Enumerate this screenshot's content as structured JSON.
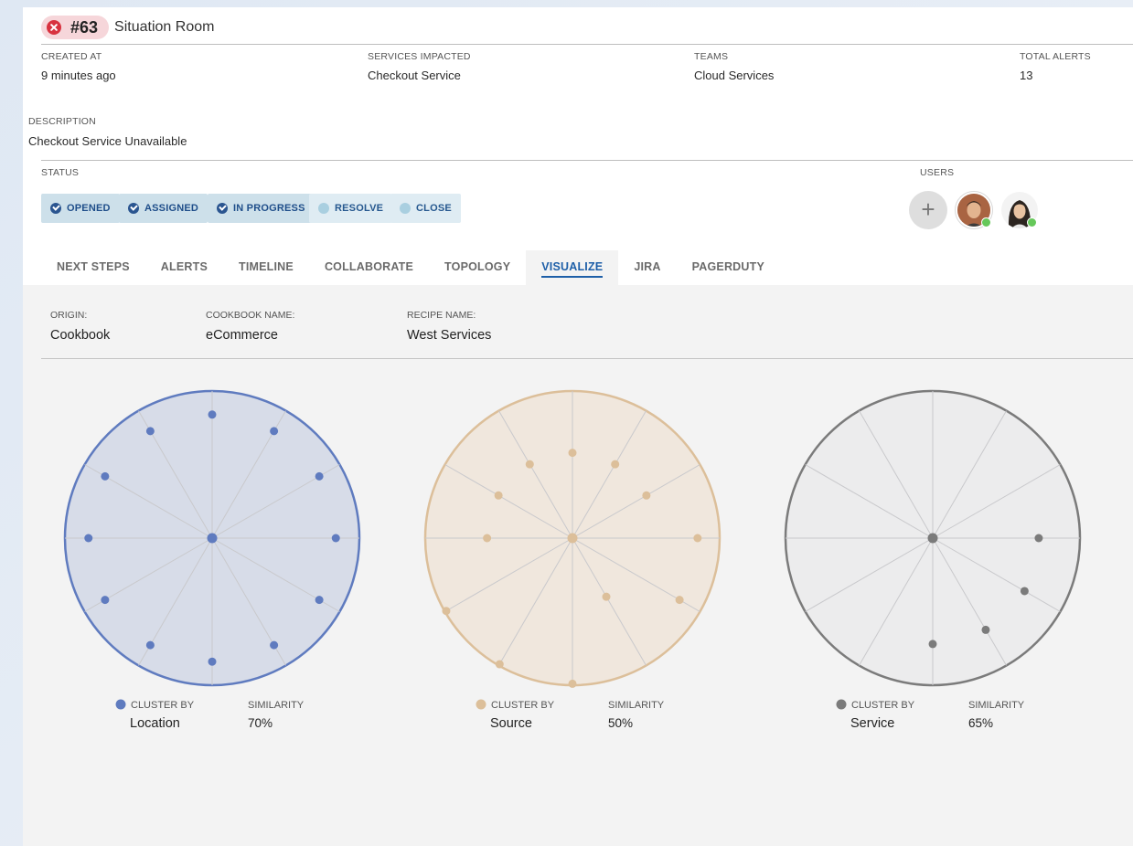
{
  "header": {
    "id": "#63",
    "title": "Situation Room"
  },
  "details": {
    "created_at_label": "CREATED AT",
    "created_at_value": "9 minutes ago",
    "services_label": "SERVICES IMPACTED",
    "services_value": "Checkout Service",
    "teams_label": "TEAMS",
    "teams_value": "Cloud Services",
    "alerts_label": "TOTAL ALERTS",
    "alerts_value": "13",
    "description_label": "DESCRIPTION",
    "description_value": "Checkout Service Unavailable"
  },
  "status": {
    "label": "STATUS",
    "steps": [
      {
        "label": "OPENED",
        "done": true
      },
      {
        "label": "ASSIGNED",
        "done": true
      },
      {
        "label": "IN PROGRESS",
        "done": true
      },
      {
        "label": "RESOLVE",
        "done": false
      },
      {
        "label": "CLOSE",
        "done": false
      }
    ]
  },
  "users": {
    "label": "USERS",
    "add_symbol": "+"
  },
  "tabs": [
    "NEXT STEPS",
    "ALERTS",
    "TIMELINE",
    "COLLABORATE",
    "TOPOLOGY",
    "VISUALIZE",
    "JIRA",
    "PAGERDUTY"
  ],
  "active_tab": "VISUALIZE",
  "meta": {
    "origin_label": "ORIGIN:",
    "origin_value": "Cookbook",
    "cookbook_label": "COOKBOOK NAME:",
    "cookbook_value": "eCommerce",
    "recipe_label": "RECIPE NAME:",
    "recipe_value": "West Services"
  },
  "chart_data": [
    {
      "type": "radial-cluster",
      "cluster_by_label": "CLUSTER BY",
      "cluster_by": "Location",
      "similarity_label": "SIMILARITY",
      "similarity": "70%",
      "color": "#5f7bbf",
      "fill": "#d7dce8",
      "spokes": 12,
      "points": [
        {
          "angle": 0,
          "r": 0.84
        },
        {
          "angle": 30,
          "r": 0.84
        },
        {
          "angle": 60,
          "r": 0.84
        },
        {
          "angle": 90,
          "r": 0.84
        },
        {
          "angle": 120,
          "r": 0.84
        },
        {
          "angle": 150,
          "r": 0.84
        },
        {
          "angle": 180,
          "r": 0.84
        },
        {
          "angle": 210,
          "r": 0.84
        },
        {
          "angle": 240,
          "r": 0.84
        },
        {
          "angle": 270,
          "r": 0.84
        },
        {
          "angle": 300,
          "r": 0.84
        },
        {
          "angle": 330,
          "r": 0.84
        }
      ]
    },
    {
      "type": "radial-cluster",
      "cluster_by_label": "CLUSTER BY",
      "cluster_by": "Source",
      "similarity_label": "SIMILARITY",
      "similarity": "50%",
      "color": "#dcbf9a",
      "fill": "#f0e7dd",
      "spokes": 12,
      "points": [
        {
          "angle": 0,
          "r": 0.85
        },
        {
          "angle": 30,
          "r": 0.84
        },
        {
          "angle": 60,
          "r": 0.46
        },
        {
          "angle": 90,
          "r": 0.99
        },
        {
          "angle": 120,
          "r": 0.99
        },
        {
          "angle": 150,
          "r": 0.99
        },
        {
          "angle": 180,
          "r": 0.58
        },
        {
          "angle": 210,
          "r": 0.58
        },
        {
          "angle": 240,
          "r": 0.58
        },
        {
          "angle": 270,
          "r": 0.58
        },
        {
          "angle": 300,
          "r": 0.58
        },
        {
          "angle": 330,
          "r": 0.58
        }
      ]
    },
    {
      "type": "radial-cluster",
      "cluster_by_label": "CLUSTER BY",
      "cluster_by": "Service",
      "similarity_label": "SIMILARITY",
      "similarity": "65%",
      "color": "#7b7b7b",
      "fill": "#ececed",
      "spokes": 12,
      "points": [
        {
          "angle": 0,
          "r": 0.72
        },
        {
          "angle": 30,
          "r": 0.72
        },
        {
          "angle": 60,
          "r": 0.72
        },
        {
          "angle": 90,
          "r": 0.72
        }
      ]
    }
  ]
}
